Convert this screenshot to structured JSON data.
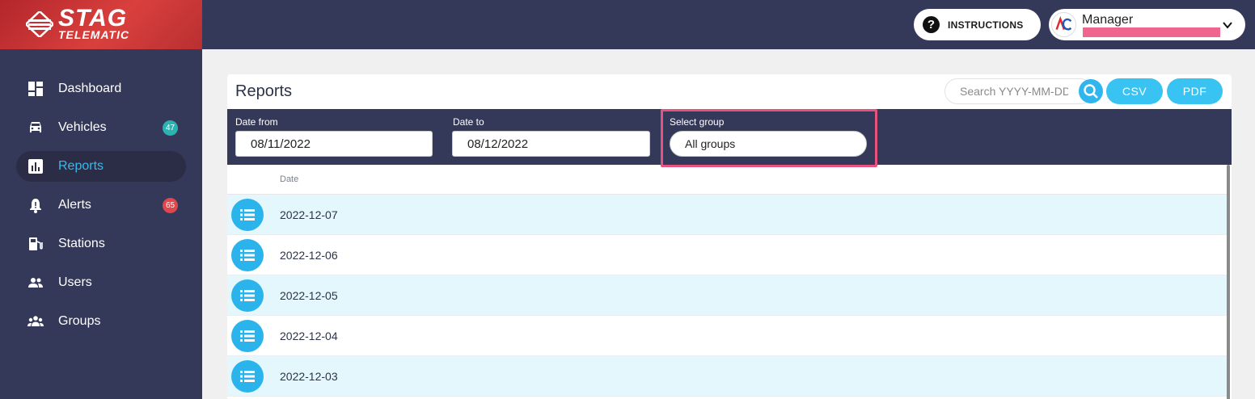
{
  "brand": {
    "name": "STAG",
    "sub": "TELEMATIC"
  },
  "sidebar": {
    "items": [
      {
        "label": "Dashboard",
        "icon": "dashboard-icon",
        "active": false
      },
      {
        "label": "Vehicles",
        "icon": "car-icon",
        "badge": "47",
        "active": false
      },
      {
        "label": "Reports",
        "icon": "chart-icon",
        "active": true
      },
      {
        "label": "Alerts",
        "icon": "bell-icon",
        "badge": "65",
        "active": false
      },
      {
        "label": "Stations",
        "icon": "fuel-station-icon",
        "active": false
      },
      {
        "label": "Users",
        "icon": "users-icon",
        "active": false
      },
      {
        "label": "Groups",
        "icon": "groups-icon",
        "active": false
      }
    ]
  },
  "header": {
    "instructions_label": "INSTRUCTIONS",
    "user_role": "Manager"
  },
  "reports": {
    "title": "Reports",
    "search_placeholder": "Search YYYY-MM-DD",
    "csv_label": "CSV",
    "pdf_label": "PDF",
    "filters": {
      "date_from_label": "Date from",
      "date_from_value": "08/11/2022",
      "date_to_label": "Date to",
      "date_to_value": "08/12/2022",
      "group_label": "Select group",
      "group_value": "All groups"
    },
    "column_date": "Date",
    "rows": [
      "2022-12-07",
      "2022-12-06",
      "2022-12-05",
      "2022-12-04",
      "2022-12-03"
    ]
  },
  "colors": {
    "sidebar_bg": "#353959",
    "accent": "#38c3f3",
    "highlight": "#e8527f",
    "row_alt": "#e3f7fd"
  }
}
